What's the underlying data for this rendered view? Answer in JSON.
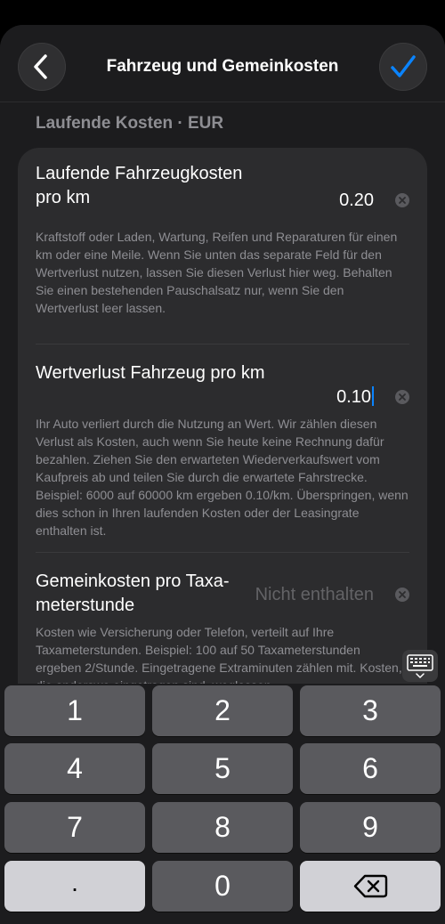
{
  "nav": {
    "title": "Fahrzeug und Gemeinkosten"
  },
  "icons": {
    "back": "chevron-left-icon",
    "confirm": "checkmark-icon",
    "clear": "clear-x-icon",
    "keyboard": "keyboard-dismiss-icon",
    "backspace": "backspace-icon"
  },
  "colors": {
    "accent": "#0a84ff",
    "background": "#1c1c1e",
    "card": "#2c2c2e",
    "secondary_text": "#8e8e93"
  },
  "section": {
    "header": "Laufende Kosten · EUR"
  },
  "fields": [
    {
      "label": "Laufende Fahrzeugkosten pro km",
      "value": "0.20",
      "placeholder": "",
      "description": "Kraftstoff oder Laden, Wartung, Reifen und Reparaturen für einen km oder eine Meile. Wenn Sie unten das separate Feld für den Wertverlust nutzen, lassen Sie diesen Verlust hier weg. Behalten Sie einen bestehenden Pauschalsatz nur, wenn Sie den Wertverlust leer lassen."
    },
    {
      "label": "Wertverlust Fahrzeug pro km",
      "value": "0.10",
      "placeholder": "",
      "description": "Ihr Auto verliert durch die Nutzung an Wert. Wir zählen diesen Verlust als Kosten, auch wenn Sie heute keine Rechnung dafür bezahlen. Ziehen Sie den erwarteten Wiederverkaufswert vom Kaufpreis ab und teilen Sie durch die erwartete Fahrstrecke. Beispiel: 6000 auf 60000 km ergeben 0.10/km. Überspringen, wenn dies schon in Ihren laufenden Kosten oder der Leasingrate enthalten ist."
    },
    {
      "label": "Gemeinkosten pro Taxa­meterstunde",
      "value": "",
      "placeholder": "Nicht enthalten",
      "description": "Kosten wie Versicherung oder Telefon, verteilt auf Ihre Taxameterstunden. Beispiel: 100 auf 50 Taxameterstunden ergeben 2/Stunde. Eingetragene Extraminuten zählen mit. Kosten, die anderswo eingetragen sind, weglassen."
    }
  ],
  "keypad": {
    "keys": [
      "1",
      "2",
      "3",
      "4",
      "5",
      "6",
      "7",
      "8",
      "9",
      ".",
      "0"
    ]
  }
}
